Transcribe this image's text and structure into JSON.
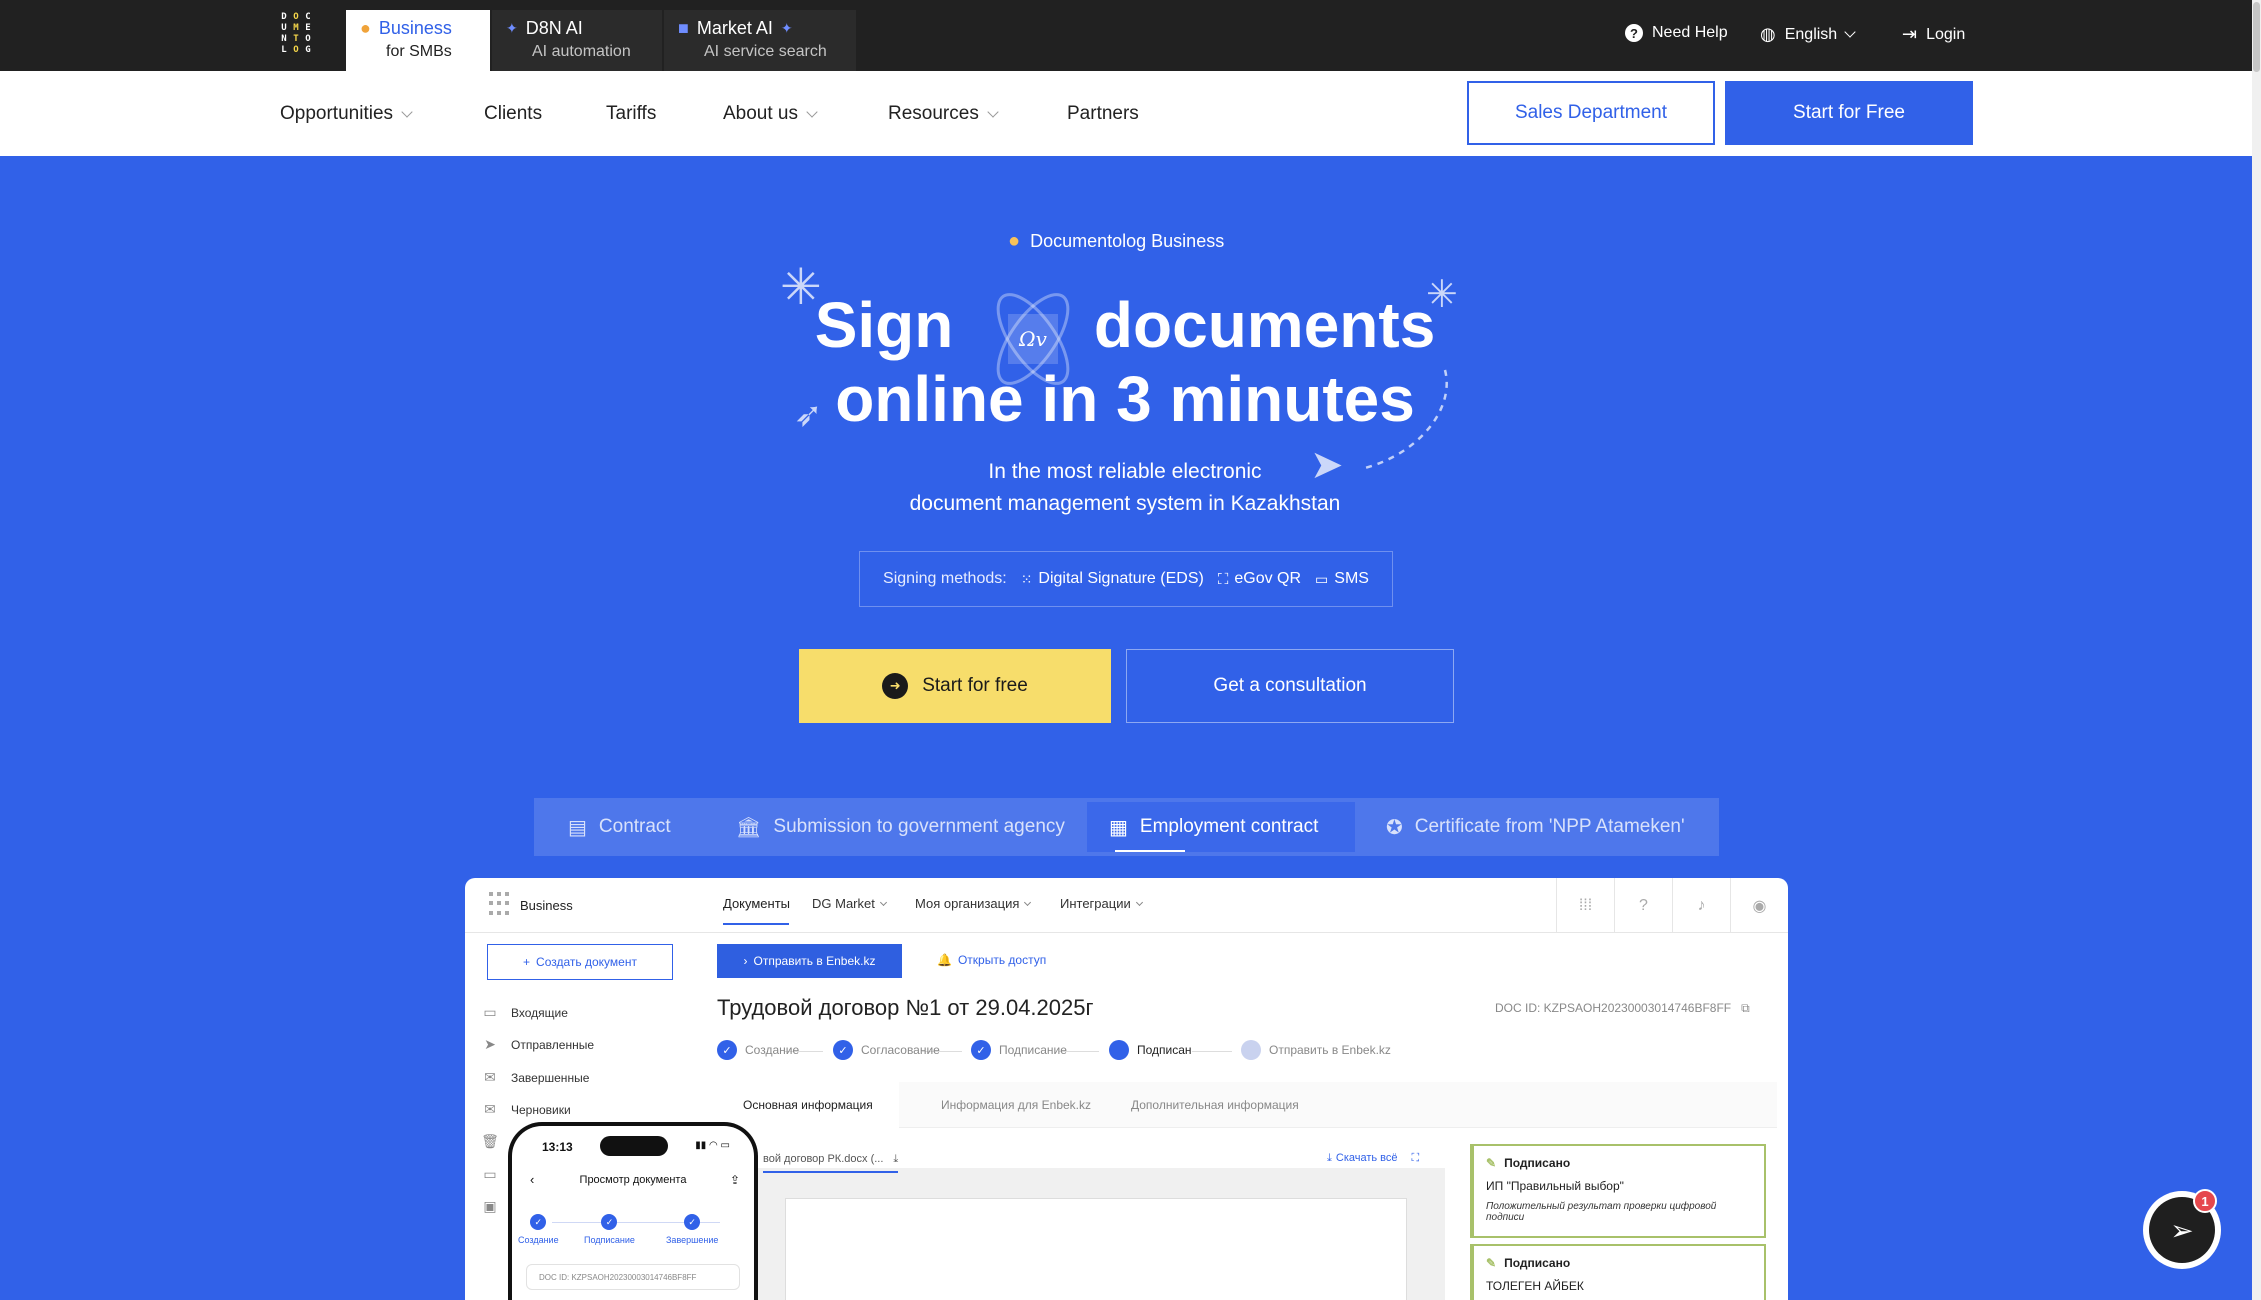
{
  "header": {
    "logo_letters": [
      "D",
      "O",
      "C",
      "U",
      "M",
      "E",
      "N",
      "T",
      "O",
      "L",
      "O",
      "G"
    ],
    "products": [
      {
        "title": "Business",
        "subtitle": "for SMBs",
        "icon": "people-icon"
      },
      {
        "title": "D8N AI",
        "subtitle": "AI automation",
        "icon": "sparkle-icon"
      },
      {
        "title": "Market AI",
        "subtitle": "AI service search",
        "icon": "bag-icon"
      }
    ],
    "help": "Need Help",
    "language": "English",
    "login": "Login"
  },
  "nav": {
    "items": [
      "Opportunities",
      "Clients",
      "Tariffs",
      "About us",
      "Resources",
      "Partners"
    ],
    "sales_button": "Sales Department",
    "start_button": "Start for Free"
  },
  "hero": {
    "badge": "Documentolog Business",
    "title_word1": "Sign",
    "title_word2": "documents",
    "title_line2": "online in 3 minutes",
    "subtitle_line1": "In the most reliable electronic",
    "subtitle_line2": "document management system in Kazakhstan",
    "methods_label": "Signing methods:",
    "methods": [
      "Digital Signature (EDS)",
      "eGov QR",
      "SMS"
    ],
    "cta_primary": "Start for free",
    "cta_secondary": "Get a consultation"
  },
  "doc_tabs": [
    "Contract",
    "Submission to government agency",
    "Employment contract",
    "Certificate from 'NPP Atameken'"
  ],
  "app": {
    "brand": "Business",
    "menu": [
      "Документы",
      "DG Market",
      "Моя организация",
      "Интеграции"
    ],
    "create_button": "Создать документ",
    "sidebar": [
      "Входящие",
      "Отправленные",
      "Завершенные",
      "Черновики"
    ],
    "send_button": "Отправить в Enbek.kz",
    "access_button": "Открыть доступ",
    "doc_title": "Трудовой договор №1 от 29.04.2025г",
    "doc_id": "DOC ID: KZPSAOH20230003014746BF8FF",
    "steps": [
      "Создание",
      "Согласование",
      "Подписание",
      "Подписан",
      "Отправить в Enbek.kz"
    ],
    "sub_tabs": [
      "Основная информация",
      "Информация для Enbek.kz",
      "Дополнительная информация"
    ],
    "file_name": "вой договор РК.docx (...",
    "download_all": "Скачать всё",
    "signatures": [
      {
        "status": "Подписано",
        "name": "ИП \"Правильный выбор\"",
        "result": "Положительный результат проверки цифровой подписи"
      },
      {
        "status": "Подписано",
        "name": "ТОЛЕГЕН АЙБЕК",
        "result": ""
      }
    ]
  },
  "phone": {
    "time": "13:13",
    "title": "Просмотр документа",
    "steps": [
      "Создание",
      "Подписание",
      "Завершение"
    ],
    "doc_id": "DOC ID:  KZPSAOH20230003014746BF8FF"
  },
  "chat": {
    "badge_count": "1"
  },
  "colors": {
    "primary": "#3161E8",
    "topbar": "#212121",
    "cta_yellow": "#F7DD6B",
    "signed_green": "#A8C16A"
  }
}
